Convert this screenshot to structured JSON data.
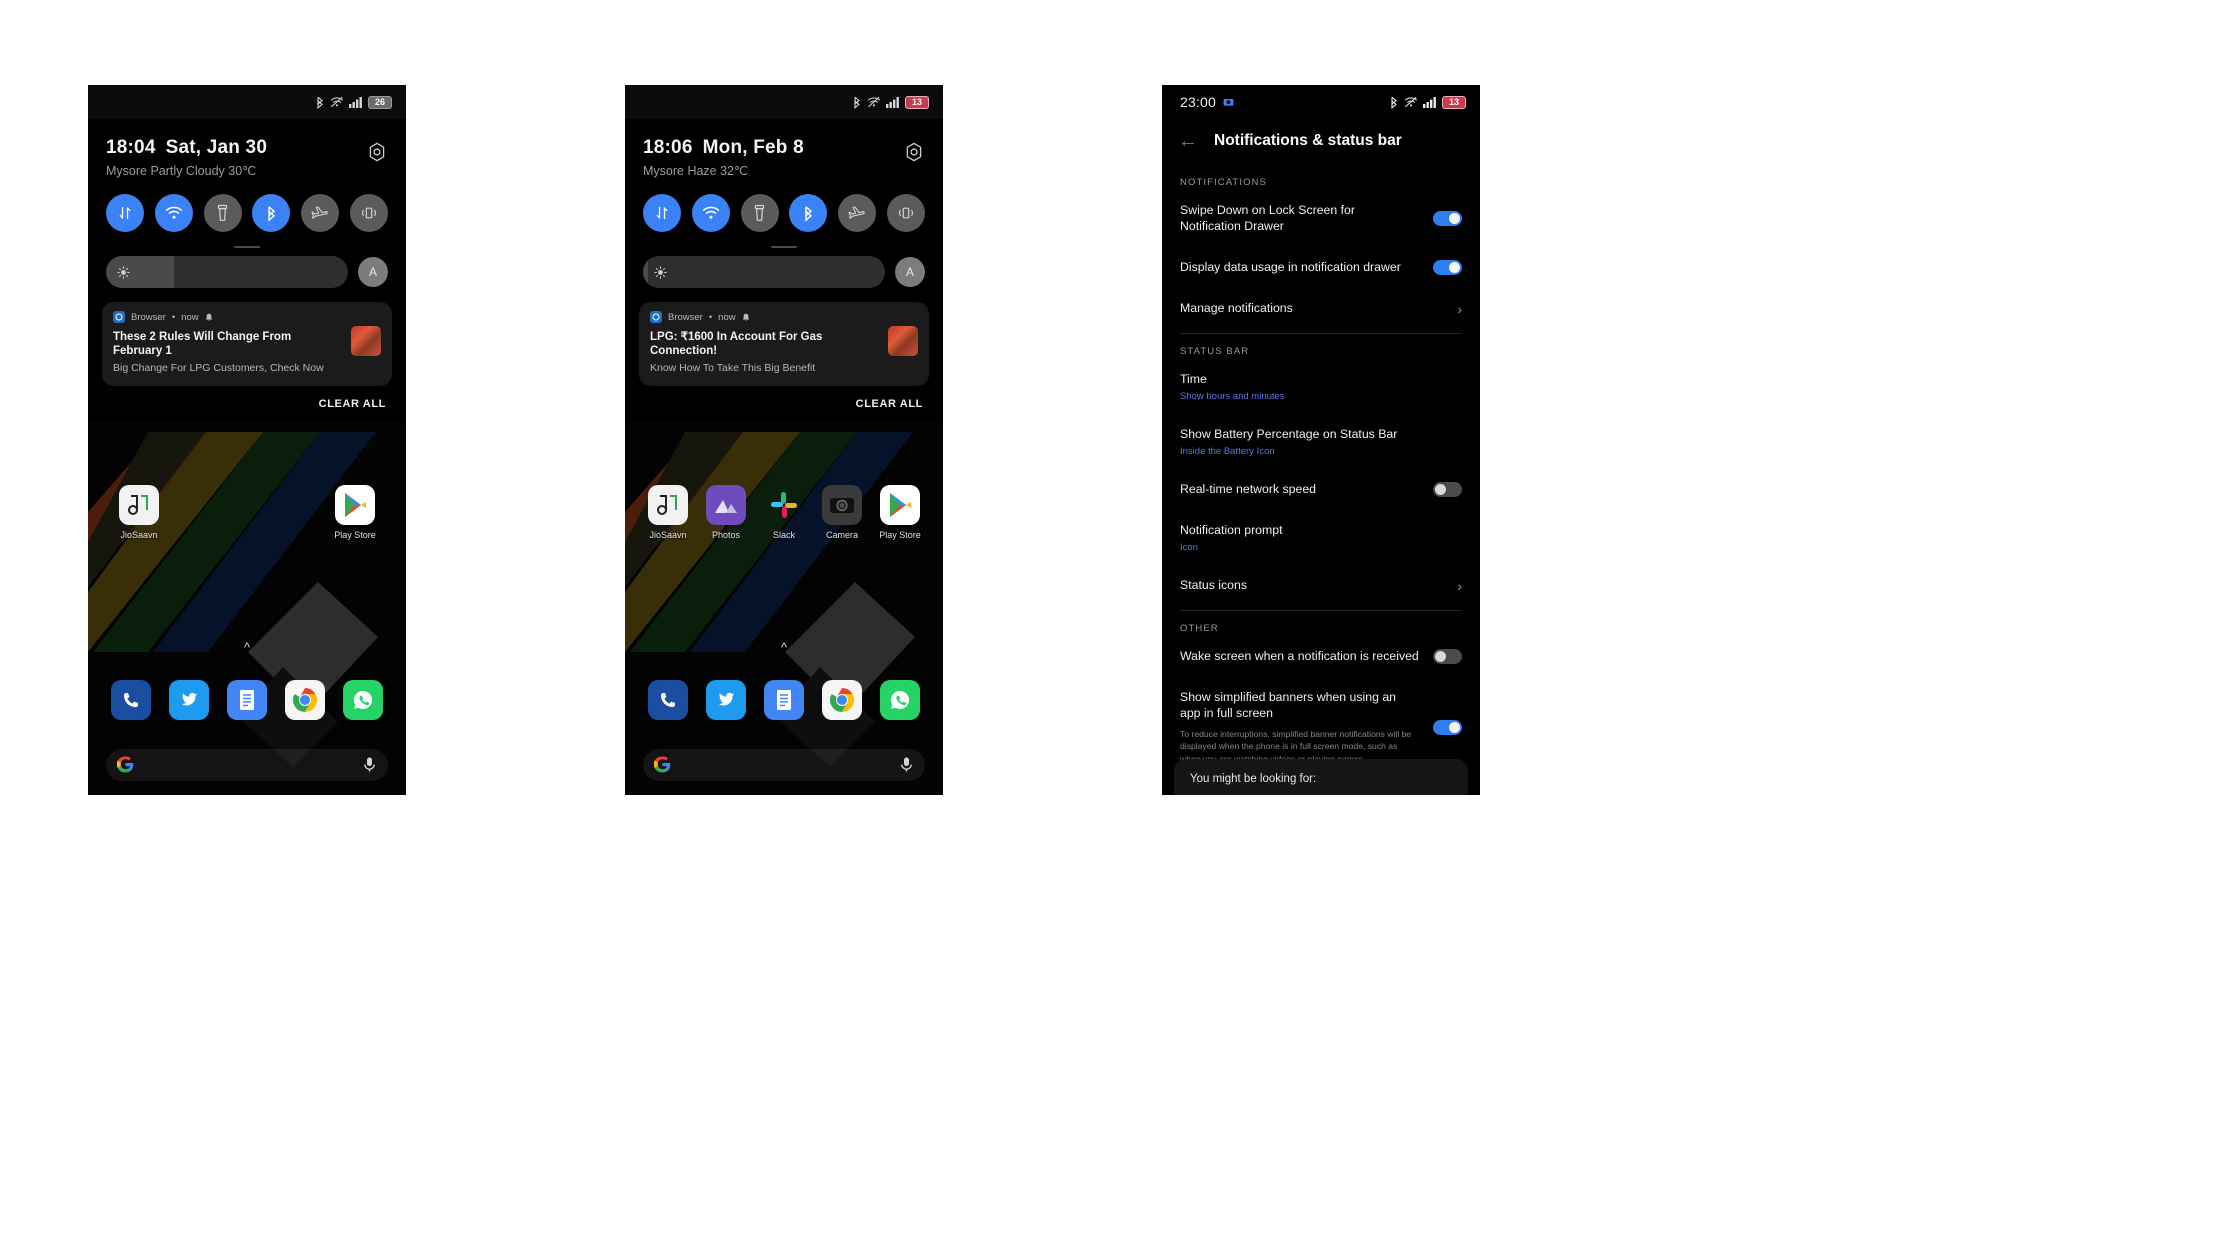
{
  "screens": [
    {
      "id": "quick-settings-jan30",
      "status_bar": {
        "icons": [
          "bluetooth-icon",
          "wifi-off-icon",
          "mobile-signal-icon"
        ],
        "battery": "26",
        "battery_state": "dim"
      },
      "quick_settings": {
        "time": "18:04",
        "date": "Sat, Jan 30",
        "weather": "Mysore Partly Cloudy 30℃",
        "gear_label": "settings-shortcut",
        "tiles": [
          {
            "name": "mobile-data-tile",
            "icon": "data-arrows-icon",
            "active": true
          },
          {
            "name": "wifi-tile",
            "icon": "wifi-icon",
            "active": true
          },
          {
            "name": "flashlight-tile",
            "icon": "flashlight-icon",
            "active": false
          },
          {
            "name": "bluetooth-tile",
            "icon": "bluetooth-icon",
            "active": true
          },
          {
            "name": "airplane-mode-tile",
            "icon": "airplane-icon",
            "active": false
          },
          {
            "name": "vibrate-tile",
            "icon": "vibrate-icon",
            "active": false
          }
        ],
        "brightness_percent": 28,
        "auto_brightness_label": "A"
      },
      "notification": {
        "app": "Browser",
        "time": "now",
        "title": "These 2 Rules Will Change From February 1",
        "subtitle": "Big Change For LPG Customers, Check Now"
      },
      "clear_all_label": "CLEAR ALL",
      "home": {
        "apps_row1": [
          {
            "label": "JioSaavn",
            "icon": "jiosaavn-icon"
          },
          {
            "label": "Play Store",
            "icon": "play-store-icon"
          }
        ],
        "apps_row1_layout": "edges",
        "dock": [
          {
            "label": "Phone",
            "icon": "phone-icon"
          },
          {
            "label": "Twitter",
            "icon": "twitter-icon"
          },
          {
            "label": "Docs",
            "icon": "docs-icon"
          },
          {
            "label": "Chrome",
            "icon": "chrome-icon"
          },
          {
            "label": "WhatsApp",
            "icon": "whatsapp-icon"
          }
        ],
        "search": {
          "icon": "google-g-icon",
          "mic": "microphone-icon"
        }
      }
    },
    {
      "id": "quick-settings-feb8",
      "status_bar": {
        "icons": [
          "bluetooth-icon",
          "wifi-off-icon",
          "mobile-signal-icon"
        ],
        "battery": "13",
        "battery_state": "low"
      },
      "quick_settings": {
        "time": "18:06",
        "date": "Mon, Feb 8",
        "weather": "Mysore Haze 32℃",
        "gear_label": "settings-shortcut",
        "tiles": [
          {
            "name": "mobile-data-tile",
            "icon": "data-arrows-icon",
            "active": true
          },
          {
            "name": "wifi-tile",
            "icon": "wifi-icon",
            "active": true
          },
          {
            "name": "flashlight-tile",
            "icon": "flashlight-icon",
            "active": false
          },
          {
            "name": "bluetooth-tile",
            "icon": "bluetooth-icon",
            "active": true
          },
          {
            "name": "airplane-mode-tile",
            "icon": "airplane-icon",
            "active": false
          },
          {
            "name": "vibrate-tile",
            "icon": "vibrate-icon",
            "active": false
          }
        ],
        "brightness_percent": 2,
        "auto_brightness_label": "A"
      },
      "notification": {
        "app": "Browser",
        "time": "now",
        "title": "LPG: ₹1600 In Account For Gas Connection!",
        "subtitle": "Know How To Take This Big Benefit"
      },
      "clear_all_label": "CLEAR ALL",
      "home": {
        "apps_row1": [
          {
            "label": "JioSaavn",
            "icon": "jiosaavn-icon"
          },
          {
            "label": "Photos",
            "icon": "photos-icon"
          },
          {
            "label": "Slack",
            "icon": "slack-icon"
          },
          {
            "label": "Camera",
            "icon": "camera-icon"
          },
          {
            "label": "Play Store",
            "icon": "play-store-icon"
          }
        ],
        "apps_row1_layout": "spread",
        "dock": [
          {
            "label": "Phone",
            "icon": "phone-icon"
          },
          {
            "label": "Twitter",
            "icon": "twitter-icon"
          },
          {
            "label": "Docs",
            "icon": "docs-icon"
          },
          {
            "label": "Chrome",
            "icon": "chrome-icon"
          },
          {
            "label": "WhatsApp",
            "icon": "whatsapp-icon"
          }
        ],
        "search": {
          "icon": "google-g-icon",
          "mic": "microphone-icon"
        }
      }
    }
  ],
  "settings": {
    "status_bar": {
      "time": "23:00",
      "left_icon": "camera-notification-icon",
      "icons": [
        "bluetooth-icon",
        "wifi-off-icon",
        "mobile-signal-icon"
      ],
      "battery": "13",
      "battery_state": "low"
    },
    "back_label": "back-arrow",
    "title": "Notifications & status bar",
    "groups": [
      {
        "label": "NOTIFICATIONS",
        "rows": [
          {
            "title": "Swipe Down on Lock Screen for Notification Drawer",
            "sub": "",
            "desc": "",
            "control": "switch",
            "value": "on",
            "name": "swipe-down-lock-screen-row"
          },
          {
            "title": "Display data usage in notification drawer",
            "sub": "",
            "desc": "",
            "control": "switch",
            "value": "on",
            "name": "display-data-usage-row"
          },
          {
            "title": "Manage notifications",
            "sub": "",
            "desc": "",
            "control": "chevron",
            "value": "",
            "name": "manage-notifications-row"
          }
        ]
      },
      {
        "label": "STATUS BAR",
        "rows": [
          {
            "title": "Time",
            "sub": "Show hours and minutes",
            "desc": "",
            "control": "none",
            "value": "",
            "name": "time-row"
          },
          {
            "title": "Show Battery Percentage on Status Bar",
            "sub": "Inside the Battery Icon",
            "desc": "",
            "control": "none",
            "value": "",
            "name": "battery-percentage-row"
          },
          {
            "title": "Real-time network speed",
            "sub": "",
            "desc": "",
            "control": "switch",
            "value": "off",
            "name": "realtime-network-speed-row"
          },
          {
            "title": "Notification prompt",
            "sub": "Icon",
            "desc": "",
            "control": "none",
            "value": "",
            "name": "notification-prompt-row"
          },
          {
            "title": "Status icons",
            "sub": "",
            "desc": "",
            "control": "chevron",
            "value": "",
            "name": "status-icons-row"
          }
        ]
      },
      {
        "label": "OTHER",
        "rows": [
          {
            "title": "Wake screen when a notification is received",
            "sub": "",
            "desc": "",
            "control": "switch",
            "value": "off",
            "name": "wake-screen-row"
          },
          {
            "title": "Show simplified banners when using an app in full screen",
            "sub": "",
            "desc": "To reduce interruptions, simplified banner notifications will be displayed when the phone is in full screen mode, such as when you are watching videos or playing games.",
            "control": "switch",
            "value": "on",
            "name": "simplified-banners-row"
          }
        ]
      }
    ],
    "footer_card": {
      "title": "You might be looking for:"
    }
  }
}
